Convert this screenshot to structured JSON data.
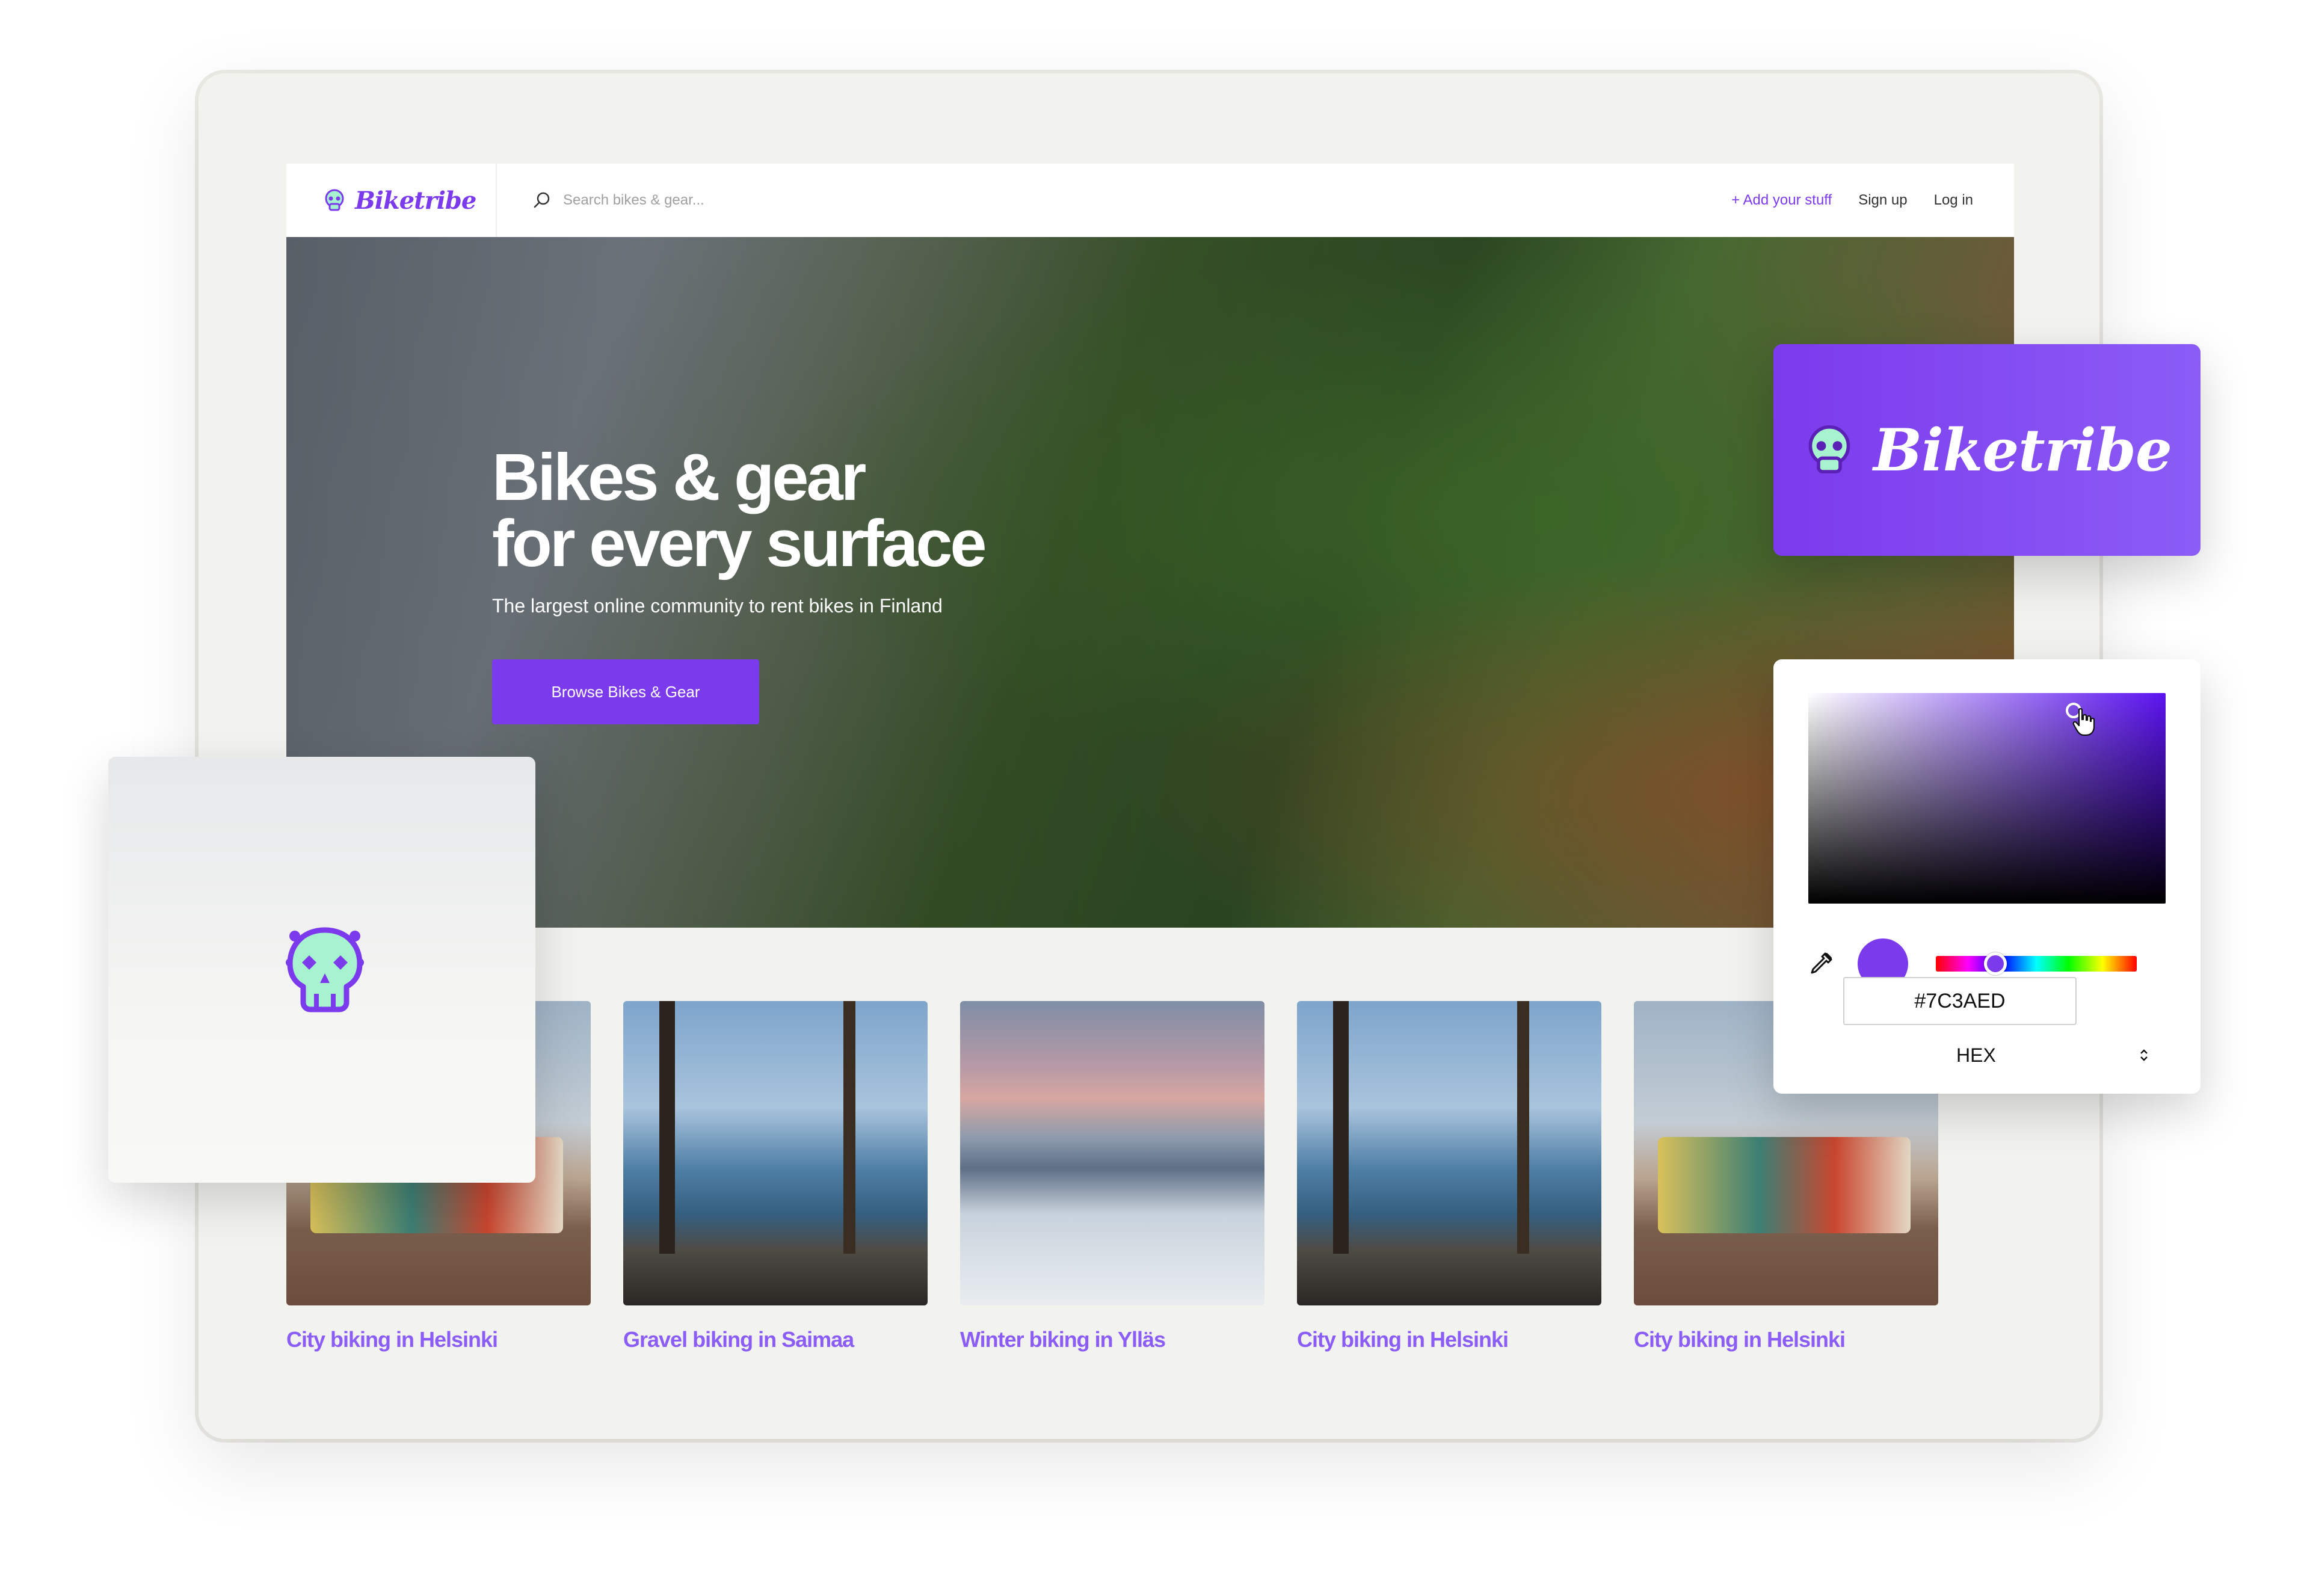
{
  "brand": {
    "name": "Biketribe",
    "accent": "#7C3AED"
  },
  "nav": {
    "search_placeholder": "Search bikes & gear...",
    "add_label": "+ Add your stuff",
    "signup_label": "Sign up",
    "login_label": "Log in"
  },
  "hero": {
    "title_line1": "Bikes & gear",
    "title_line2": "for every surface",
    "subtitle": "The largest online community to rent bikes in Finland",
    "cta_label": "Browse Bikes & Gear"
  },
  "cards": [
    {
      "title": "City biking in Helsinki",
      "image": "city"
    },
    {
      "title": "Gravel biking in Saimaa",
      "image": "lake"
    },
    {
      "title": "Winter biking in Ylläs",
      "image": "winter"
    },
    {
      "title": "City biking in Helsinki",
      "image": "lake"
    },
    {
      "title": "City biking in Helsinki",
      "image": "city"
    }
  ],
  "logo_card": {
    "name": "Biketribe"
  },
  "color_picker": {
    "hex_value": "#7C3AED",
    "format": "HEX",
    "icons": [
      "eyedropper-icon",
      "hand-cursor-icon",
      "updown-chevron-icon"
    ]
  }
}
